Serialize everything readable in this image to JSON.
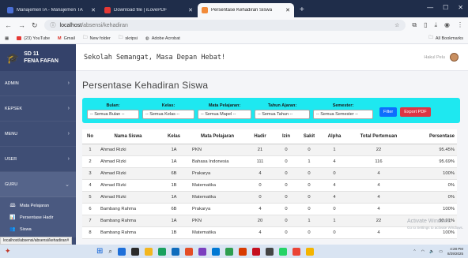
{
  "browser": {
    "tabs": [
      {
        "label": "ManajemenTA - Manajemen TA",
        "favicon_color": "#4a6fd6",
        "active": false
      },
      {
        "label": "Download file | iLovePDF",
        "favicon_color": "#e53935",
        "active": false
      },
      {
        "label": "Persentase Kehadiran Siswa",
        "favicon_color": "#f28b3a",
        "active": true
      }
    ],
    "new_tab": "+",
    "url_host": "localhost",
    "url_path": "/absensi/kehadiran",
    "bookmarks": [
      {
        "label": "(23) YouTube",
        "color": "#e53935"
      },
      {
        "label": "Gmail",
        "color": "#d93025"
      },
      {
        "label": "New folder",
        "color": "#c9a227"
      },
      {
        "label": "skripsi",
        "color": "#c9a227"
      },
      {
        "label": "Adobe Acrobat",
        "color": "#555555"
      }
    ],
    "all_bookmarks": "All Bookmarks"
  },
  "sidebar": {
    "brand_line1": "SD 11",
    "brand_line2": "FENA FAFAN",
    "items": [
      {
        "label": "ADMIN"
      },
      {
        "label": "KEPSEK"
      },
      {
        "label": "MENU"
      },
      {
        "label": "USER"
      }
    ],
    "guru": {
      "label": "GURU",
      "subitems": [
        {
          "label": "Mata Pelajaran"
        },
        {
          "label": "Persentase Hadir"
        },
        {
          "label": "Siswa"
        }
      ]
    },
    "status_url": "localhost/absensi/absensi/kehadiran#"
  },
  "header": {
    "slogan": "Sekolah Semangat, Masa Depan Hebat!",
    "user": "Hakul Pelu"
  },
  "page": {
    "title": "Persentase Kehadiran Siswa",
    "filters": [
      {
        "label": "Bulan:",
        "value": "-- Semua Bulan --"
      },
      {
        "label": "Kelas:",
        "value": "-- Semua Kelas --"
      },
      {
        "label": "Mata Pelajaran:",
        "value": "-- Semua Mapel --"
      },
      {
        "label": "Tahun Ajaran:",
        "value": "-- Semua Tahun --"
      },
      {
        "label": "Semester:",
        "value": "-- Semua Semester --"
      }
    ],
    "filter_button": "Filter",
    "export_button": "Export PDF"
  },
  "table": {
    "headers": [
      "No",
      "Nama Siswa",
      "Kelas",
      "Mata Pelajaran",
      "Hadir",
      "Izin",
      "Sakit",
      "Alpha",
      "Total Pertemuan",
      "Persentase"
    ],
    "rows": [
      [
        "1",
        "Ahmad Rizki",
        "1A",
        "PKN",
        "21",
        "0",
        "0",
        "1",
        "22",
        "95.45%"
      ],
      [
        "2",
        "Ahmad Rizki",
        "1A",
        "Bahasa Indonesia",
        "111",
        "0",
        "1",
        "4",
        "116",
        "95.69%"
      ],
      [
        "3",
        "Ahmad Rizki",
        "6B",
        "Prakarya",
        "4",
        "0",
        "0",
        "0",
        "4",
        "100%"
      ],
      [
        "4",
        "Ahmad Rizki",
        "1B",
        "Matematika",
        "0",
        "0",
        "0",
        "4",
        "4",
        "0%"
      ],
      [
        "5",
        "Ahmad Rizki",
        "1A",
        "Matematika",
        "0",
        "0",
        "0",
        "4",
        "4",
        "0%"
      ],
      [
        "6",
        "Bambang Rahma",
        "6B",
        "Prakarya",
        "4",
        "0",
        "0",
        "0",
        "4",
        "100%"
      ],
      [
        "7",
        "Bambang Rahma",
        "1A",
        "PKN",
        "20",
        "0",
        "1",
        "1",
        "22",
        "90.91%"
      ],
      [
        "8",
        "Bambang Rahma",
        "1B",
        "Matematika",
        "4",
        "0",
        "0",
        "0",
        "4",
        "100%"
      ]
    ]
  },
  "watermark": {
    "line1": "Activate Windows",
    "line2": "Go to Settings to activate Windows."
  },
  "taskbar": {
    "time": "4:28 PM",
    "date": "8/29/2025",
    "pinned_colors": [
      "#1e6fd9",
      "#2b2b2b",
      "#f3b61f",
      "#1aa15f",
      "#0f6cbd",
      "#e44d26",
      "#7b3fbf",
      "#0078d4",
      "#2e9e4f",
      "#d83b01",
      "#c50f1f",
      "#444444",
      "#25d366",
      "#ea4335",
      "#f4b400"
    ]
  }
}
